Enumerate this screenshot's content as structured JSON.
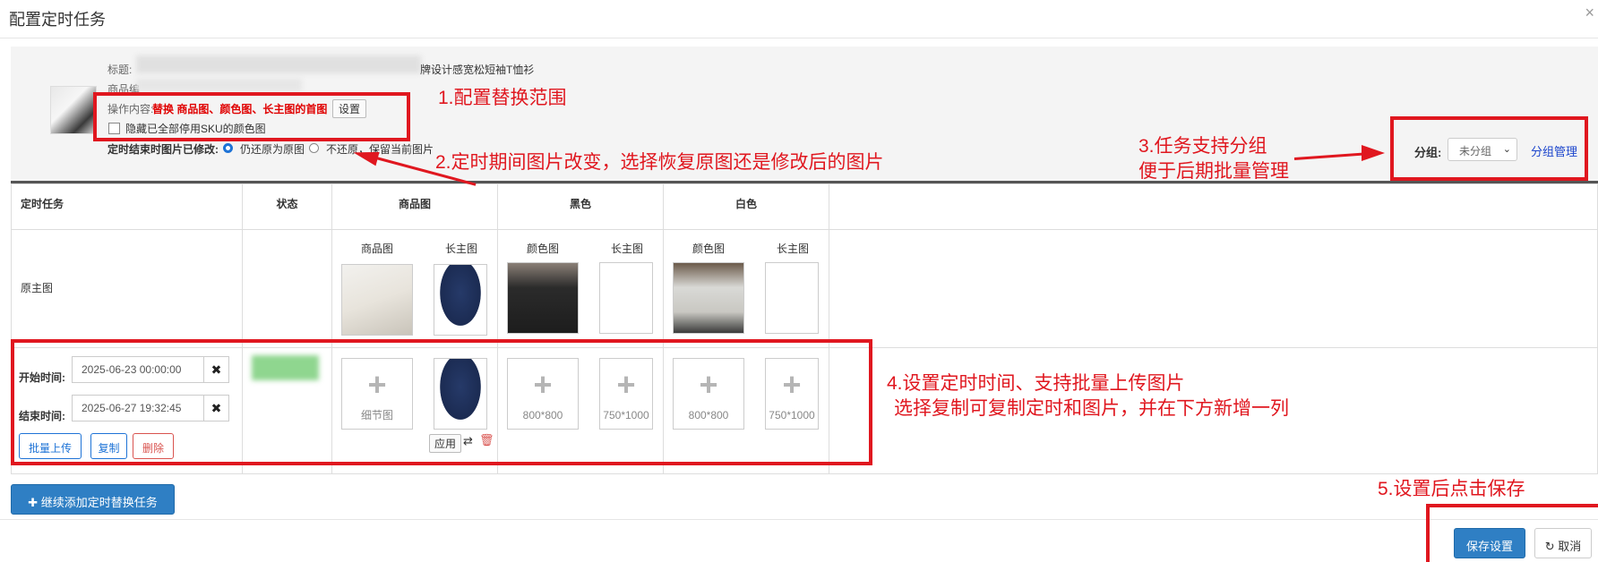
{
  "dialog": {
    "title": "配置定时任务",
    "close_glyph": "×"
  },
  "product": {
    "title_label": "标题:",
    "title_visible_suffix": "牌设计感宽松短袖T恤衫",
    "code_label": "商品编",
    "operation_label": "操作内容:",
    "operation_value": "替换 商品图、颜色图、长主图的首图",
    "set_button": "设置",
    "hide_sku_label": "隐藏已全部停用SKU的颜色图",
    "restore_label": "定时结束时图片已修改:",
    "restore_option_1": "仍还原为原图",
    "restore_option_2": "不还原，保留当前图片"
  },
  "group": {
    "label": "分组:",
    "selected": "未分组",
    "manage_link": "分组管理"
  },
  "table": {
    "headers": [
      "定时任务",
      "状态",
      "商品图",
      "黑色",
      "白色"
    ],
    "sub_headers": {
      "product": [
        "商品图",
        "长主图"
      ],
      "black": [
        "颜色图",
        "长主图"
      ],
      "white": [
        "颜色图",
        "长主图"
      ]
    },
    "original_row_label": "原主图",
    "task": {
      "start_label": "开始时间:",
      "start_value": "2025-06-23 00:00:00",
      "end_label": "结束时间:",
      "end_value": "2025-06-27 19:32:45",
      "clear_glyph": "✖",
      "batch_upload": "批量上传",
      "copy": "复制",
      "delete": "删除",
      "detail_slot": "细节图",
      "apply": "应用",
      "slot_800": "800*800",
      "slot_750": "750*1000"
    }
  },
  "add_task_button": "继续添加定时替换任务",
  "footer": {
    "save": "保存设置",
    "cancel": "取消"
  },
  "annotations": {
    "a1": "1.配置替换范围",
    "a2": "2.定时期间图片改变，选择恢复原图还是修改后的图片",
    "a3_line1": "3.任务支持分组",
    "a3_line2": "便于后期批量管理",
    "a4_line1": "4.设置定时时间、支持批量上传图片",
    "a4_line2": "选择复制可复制定时和图片，并在下方新增一列",
    "a5": "5.设置后点击保存"
  },
  "colors": {
    "annotation_red": "#e0171f",
    "primary_blue": "#2f7fc4",
    "link_blue": "#1a44cc"
  }
}
